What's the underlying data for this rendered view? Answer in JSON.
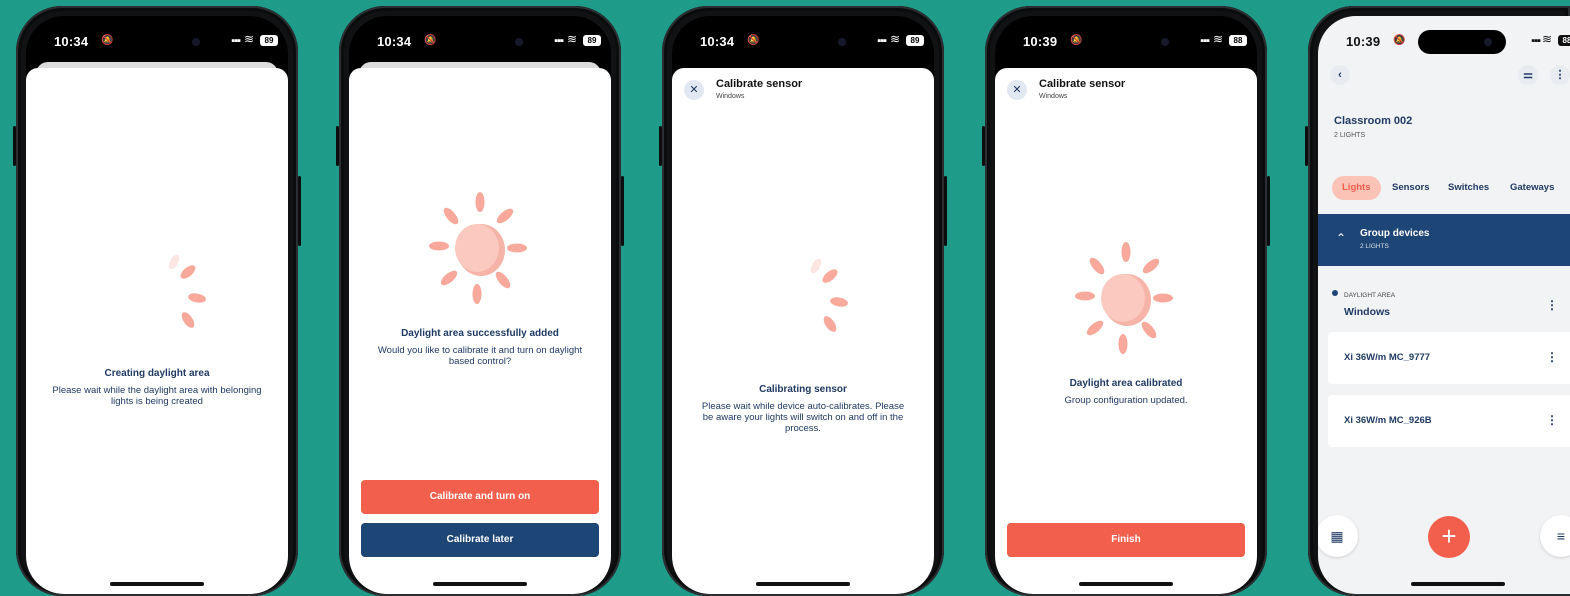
{
  "colors": {
    "background": "#1f9b8a",
    "accent": "#f25f4c",
    "navy": "#1d4575",
    "sun": "#f8a99b"
  },
  "screens": [
    {
      "status": {
        "time": "10:34",
        "battery": "89"
      },
      "title": "Creating daylight area",
      "description": "Please wait while the daylight area with belonging lights is being created"
    },
    {
      "status": {
        "time": "10:34",
        "battery": "89"
      },
      "title": "Daylight area successfully added",
      "description": "Would you like to calibrate it and turn on daylight based control?",
      "primary_button": "Calibrate and turn on",
      "secondary_button": "Calibrate later"
    },
    {
      "status": {
        "time": "10:34",
        "battery": "89"
      },
      "header_title": "Calibrate sensor",
      "header_sub": "Windows",
      "title": "Calibrating sensor",
      "description": "Please wait while device auto-calibrates. Please be aware your lights will switch on and off in the process."
    },
    {
      "status": {
        "time": "10:39",
        "battery": "88"
      },
      "header_title": "Calibrate sensor",
      "header_sub": "Windows",
      "title": "Daylight area calibrated",
      "description": "Group configuration updated.",
      "primary_button": "Finish"
    },
    {
      "status": {
        "time": "10:39",
        "battery": "88"
      },
      "room_title": "Classroom 002",
      "room_sub": "2 LIGHTS",
      "tabs": [
        "Lights",
        "Sensors",
        "Switches",
        "Gateways"
      ],
      "group_title": "Group devices",
      "group_sub": "2 LIGHTS",
      "daylight_label": "DAYLIGHT AREA",
      "daylight_name": "Windows",
      "devices": [
        "Xi 36W/m MC_9777",
        "Xi 36W/m MC_926B"
      ]
    }
  ]
}
